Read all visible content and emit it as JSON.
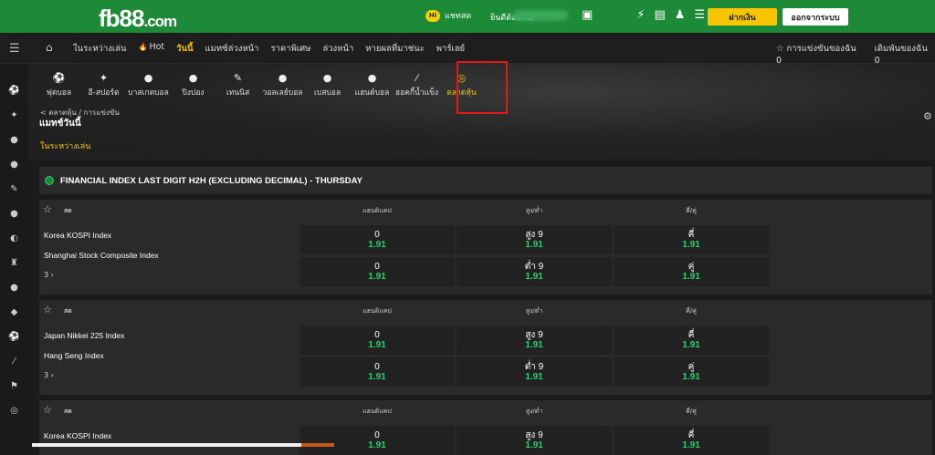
{
  "header": {
    "logo": "fb88",
    "logo_suffix": ".com",
    "chat_badge": "Hi",
    "chat_label": "แชทสด",
    "welcome": "ยินดีต้อนรับ,",
    "deposit_label": "ฝากเงิน",
    "logout_label": "ออกจากระบบ",
    "accent": "#1c8a37"
  },
  "nav": {
    "items": [
      "ในระหว่างเล่น",
      "Hot",
      "วันนี้",
      "แมทซ์ล่วงหน้า",
      "ราคาพิเศษ",
      "ล่วงหน้า",
      "หายผลที่มาช่นะ",
      "พาร์เลย์"
    ],
    "active_index": 2,
    "right": [
      "การแข่งขันของฉัน 0",
      "เดิมพันของฉัน 0"
    ]
  },
  "sports": [
    {
      "icon": "soccer-icon",
      "label": "ฟุตบอล"
    },
    {
      "icon": "esports-icon",
      "label": "อี-สปอร์ต"
    },
    {
      "icon": "basketball-icon",
      "label": "บาสเกตบอล"
    },
    {
      "icon": "table-tennis-icon",
      "label": "ปิงปอง"
    },
    {
      "icon": "tennis-icon",
      "label": "เทนนิส"
    },
    {
      "icon": "volleyball-icon",
      "label": "วอลเลย์บอล"
    },
    {
      "icon": "baseball-icon",
      "label": "เบสบอล"
    },
    {
      "icon": "handball-icon",
      "label": "แฮนด์บอล"
    },
    {
      "icon": "hockey-icon",
      "label": "ฮอคกี้น้ำแข็ง"
    },
    {
      "icon": "stock-market-icon",
      "label": "ตลาดหุ้น"
    }
  ],
  "breadcrumb": "< ตลาดหุ้น / การแข่งขัน",
  "page_title": "แมทช์วันนี้",
  "live_label": "ในระหว่างเล่น",
  "league_title": "FINANCIAL INDEX LAST DIGIT H2H (EXCLUDING DECIMAL) - THURSDAY",
  "column_headers": [
    "แฮนดิแคป",
    "สูง/ต่ำ",
    "คี่/คู่"
  ],
  "matches": [
    {
      "live": "สด",
      "home": "Korea KOSPI Index",
      "away": "Shanghai Stock Composite Index",
      "more": "3",
      "rows": [
        [
          {
            "line": "0",
            "odds": "1.91"
          },
          {
            "line": "สูง 9",
            "odds": "1.91"
          },
          {
            "line": "คี่",
            "odds": "1.91"
          }
        ],
        [
          {
            "line": "0",
            "odds": "1.91"
          },
          {
            "line": "ต่ำ 9",
            "odds": "1.91"
          },
          {
            "line": "คู่",
            "odds": "1.91"
          }
        ]
      ]
    },
    {
      "live": "สด",
      "home": "Japan Nikkei 225 Index",
      "away": "Hang Seng Index",
      "more": "3",
      "rows": [
        [
          {
            "line": "0",
            "odds": "1.91"
          },
          {
            "line": "สูง 9",
            "odds": "1.91"
          },
          {
            "line": "คี่",
            "odds": "1.91"
          }
        ],
        [
          {
            "line": "0",
            "odds": "1.91"
          },
          {
            "line": "ต่ำ 9",
            "odds": "1.91"
          },
          {
            "line": "คู่",
            "odds": "1.91"
          }
        ]
      ]
    },
    {
      "live": "สด",
      "home": "Korea KOSPI Index",
      "away": "",
      "more": "",
      "rows": [
        [
          {
            "line": "0",
            "odds": "1.91"
          },
          {
            "line": "สูง 9",
            "odds": "1.91"
          },
          {
            "line": "คี่",
            "odds": "1.91"
          }
        ]
      ]
    }
  ],
  "colors": {
    "odds": "#2ecc71",
    "highlight": "#f7c600",
    "selection_box": "#e01919"
  }
}
